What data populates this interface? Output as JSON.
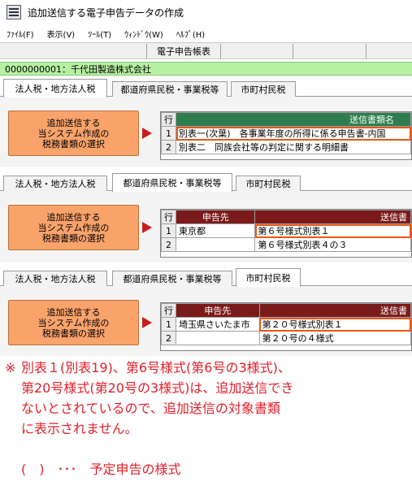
{
  "window": {
    "title": "追加送信する電子申告データの作成"
  },
  "menu": [
    "ﾌｧｲﾙ(F)",
    "表示(V)",
    "ﾂｰﾙ(T)",
    "ｳｨﾝﾄﾞｳ(W)",
    "ﾍﾙﾌﾟ(H)"
  ],
  "toolbar": {
    "button_label": "電子申告帳表"
  },
  "company": {
    "label": "0000000001：千代田製造株式会社"
  },
  "tab_labels": {
    "corporate": "法人税・地方法人税",
    "prefectural": "都道府県民税・事業税等",
    "municipal": "市町村民税"
  },
  "select_button_label": "追加送信する\n当システム作成の\n税務書類の選択",
  "panel1": {
    "headers": {
      "idx": "行",
      "name": "送信書類名"
    },
    "rows": [
      {
        "idx": "1",
        "name": "別表一(次葉)　各事業年度の所得に係る申告書-内国"
      },
      {
        "idx": "2",
        "name": "別表二　同族会社等の判定に関する明細書"
      }
    ]
  },
  "panel2": {
    "headers": {
      "idx": "行",
      "dest": "申告先",
      "doc": "送信書"
    },
    "rows": [
      {
        "idx": "1",
        "dest": "東京都",
        "doc": "第６号様式別表１"
      },
      {
        "idx": "2",
        "dest": "",
        "doc": "第６号様式別表４の３"
      }
    ]
  },
  "panel3": {
    "headers": {
      "idx": "行",
      "dest": "申告先",
      "doc": "送信書"
    },
    "rows": [
      {
        "idx": "1",
        "dest": "埼玉県さいたま市",
        "doc": "第２０号様式別表１"
      },
      {
        "idx": "2",
        "dest": "",
        "doc": "第２０号の４様式"
      }
    ]
  },
  "note": {
    "mark": "※",
    "lines": [
      "別表１(別表19)、第6号様式(第6号の3様式)、",
      "第20号様式(第20号の3様式)は、追加送信でき",
      "ないとされているので、追加送信の対象書類",
      "に表示されません。",
      "",
      "(　)　･･･　予定申告の様式"
    ]
  },
  "colors": {
    "accent_orange": "#f9a36b",
    "highlight_border": "#e8571b",
    "company_bar": "#b6f0a2",
    "note_text": "#e0202a",
    "header_green": "#2e7d4f",
    "header_maroon": "#7b1a1a"
  }
}
